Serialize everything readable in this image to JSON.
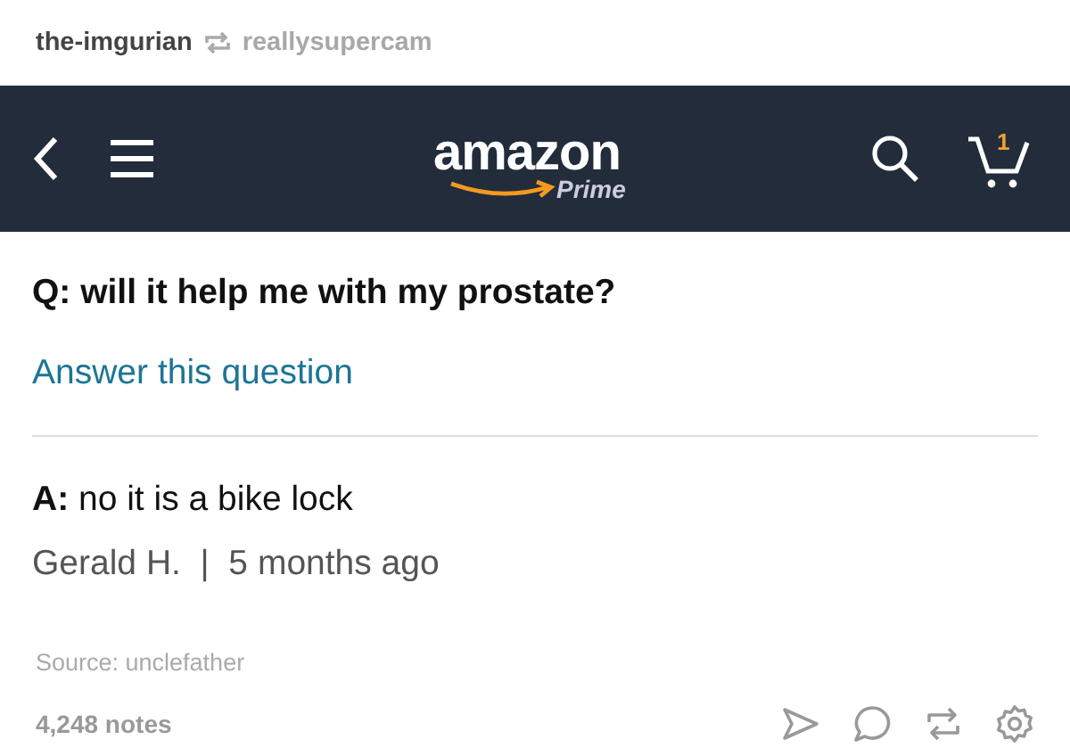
{
  "post_header": {
    "blog": "the-imgurian",
    "reblogged_from": "reallysupercam"
  },
  "app_bar": {
    "logo": "amazon",
    "logo_sub": "Prime",
    "cart_count": "1"
  },
  "question": {
    "text": "Q: will it help me with my prostate?",
    "answer_link": "Answer this question"
  },
  "answer": {
    "text": "**A:** no it is a bike lock",
    "byline": "Gerald H.  |  5 months ago"
  },
  "source": "Source: unclefather",
  "footer": {
    "notes": "4,248 notes"
  }
}
